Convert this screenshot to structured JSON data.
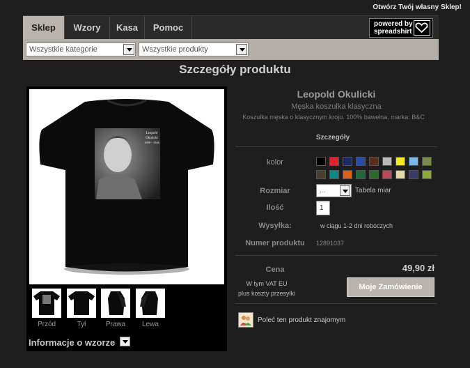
{
  "header": {
    "open_shop_link": "Otwórz Twój własny Sklep!"
  },
  "nav": {
    "tabs": [
      {
        "label": "Sklep",
        "active": true
      },
      {
        "label": "Wzory",
        "active": false
      },
      {
        "label": "Kasa",
        "active": false
      },
      {
        "label": "Pomoc",
        "active": false
      }
    ],
    "powered_by": {
      "line1": "powered by",
      "line2": "spreadshirt"
    }
  },
  "filters": {
    "category_select": "Wszystkie kategorie",
    "product_select": "Wszystkie produkty"
  },
  "page_title": "Szczegóły produktu",
  "gallery": {
    "main_image": {
      "caption_line1": "Leopold",
      "caption_line2": "Okulicki",
      "caption_line3": "1898 - 1946"
    },
    "views": [
      "Przód",
      "Tył",
      "Prawa",
      "Lewa"
    ],
    "design_info_label": "Informacje o wzorze"
  },
  "product": {
    "name": "Leopold Okulicki",
    "type": "Męska koszulka klasyczna",
    "description": "Koszulka męska o klasycznym kroju. 100% bawełna, marka: B&C",
    "details_heading": "Szczegóły",
    "color_label": "kolor",
    "colors_row1": [
      "#000000",
      "#e0202a",
      "#1a2a5e",
      "#2a4aa8",
      "#5a2e1c",
      "#b8b8b8",
      "#f4e82a",
      "#7ab8e8",
      "#7a8a4a"
    ],
    "colors_row2": [
      "#4a3e2c",
      "#0a8a8a",
      "#e0601a",
      "#1a6a3a",
      "#2a6a2a",
      "#b84a5a",
      "#e8d8a8",
      "#3a3a6a",
      "#8aaa3a"
    ],
    "size_label": "Rozmiar",
    "size_value": "...",
    "size_chart_link": "Tabela miar",
    "quantity_label": "Ilość",
    "quantity_value": "1",
    "shipping_label": "Wysyłka:",
    "shipping_value": "w ciągu 1-2 dni roboczych",
    "product_number_label": "Numer produktu",
    "product_number_value": "12891037",
    "price_label": "Cena",
    "price_value": "49,90 zł",
    "vat_line1": "W tym VAT EU",
    "vat_line2": "plus koszty przesyłki",
    "order_button": "Moje Zamówienie",
    "recommend_text": "Poleć ten produkt znajomym"
  }
}
